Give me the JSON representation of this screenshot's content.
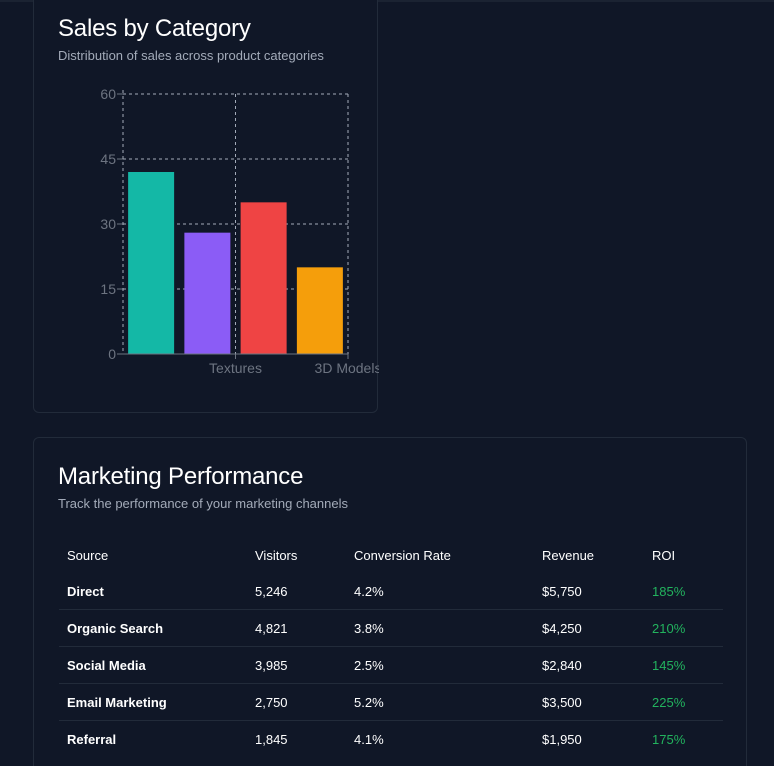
{
  "sales_card": {
    "title": "Sales by Category",
    "subtitle": "Distribution of sales across product categories"
  },
  "chart_data": {
    "type": "bar",
    "categories": [
      "",
      "Textures",
      "",
      "3D Models"
    ],
    "values": [
      42,
      28,
      35,
      20
    ],
    "colors": [
      "#14b8a6",
      "#8b5cf6",
      "#ef4444",
      "#f59e0b"
    ],
    "ylim": [
      0,
      60
    ],
    "yticks": [
      0,
      15,
      30,
      45,
      60
    ],
    "grid": true,
    "title": "",
    "xlabel": "",
    "ylabel": ""
  },
  "marketing_card": {
    "title": "Marketing Performance",
    "subtitle": "Track the performance of your marketing channels",
    "columns": [
      "Source",
      "Visitors",
      "Conversion Rate",
      "Revenue",
      "ROI"
    ],
    "rows": [
      {
        "source": "Direct",
        "visitors": "5,246",
        "conversion": "4.2%",
        "revenue": "$5,750",
        "roi": "185%"
      },
      {
        "source": "Organic Search",
        "visitors": "4,821",
        "conversion": "3.8%",
        "revenue": "$4,250",
        "roi": "210%"
      },
      {
        "source": "Social Media",
        "visitors": "3,985",
        "conversion": "2.5%",
        "revenue": "$2,840",
        "roi": "145%"
      },
      {
        "source": "Email Marketing",
        "visitors": "2,750",
        "conversion": "5.2%",
        "revenue": "$3,500",
        "roi": "225%"
      },
      {
        "source": "Referral",
        "visitors": "1,845",
        "conversion": "4.1%",
        "revenue": "$1,950",
        "roi": "175%"
      }
    ],
    "roi_color": "#22b35e"
  }
}
